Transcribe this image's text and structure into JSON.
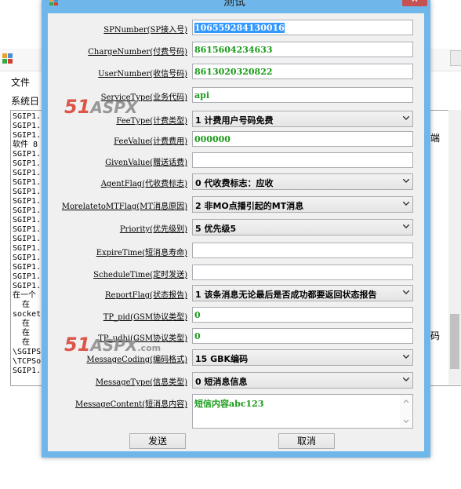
{
  "background": {
    "menu": "文件",
    "log_label": "系统日",
    "log_lines": [
      "SGIP1.",
      "SGIP1.",
      "SGIP1.",
      "软件 8",
      "SGIP1.",
      "SGIP1.",
      "SGIP1.",
      "SGIP1.",
      "SGIP1.",
      "SGIP1.",
      "SGIP1.",
      "SGIP1.",
      "SGIP1.",
      "SGIP1.",
      "SGIP1.",
      "SGIP1.",
      "SGIP1.",
      "SGIP1.",
      "SGIP1.",
      "在一个",
      "  在",
      "socket",
      "  在",
      "  在",
      "  在",
      "\\SGIPS",
      "\\TCPSo",
      "SGIP1."
    ],
    "side_text_1": "端",
    "side_text_2": "码"
  },
  "dialog": {
    "title": "测试",
    "close_glyph": "✕",
    "fields": [
      {
        "label": "SPNumber(SP接入号)",
        "type": "text",
        "value": "106559284130016",
        "selected": true
      },
      {
        "label": "ChargeNumber(付费号码)",
        "type": "text",
        "value": "8615604234633"
      },
      {
        "label": "UserNumber(收信号码)",
        "type": "text",
        "value": "8613020320822"
      },
      {
        "label": "ServiceType(业务代码)",
        "type": "text",
        "value": "api"
      },
      {
        "label": "FeeType(计费类型)",
        "type": "combo",
        "value": "1    计费用户号码免费"
      },
      {
        "label": "FeeValue(计费费用)",
        "type": "text",
        "value": "000000"
      },
      {
        "label": "GivenValue(赠送话费)",
        "type": "text",
        "value": ""
      },
      {
        "label": "AgentFlag(代收费标志)",
        "type": "combo",
        "value": "0  代收费标志：应收"
      },
      {
        "label": "MorelatetoMTFlag(MT消息原因)",
        "type": "combo",
        "value": "2    非MO点播引起的MT消息"
      },
      {
        "label": "Priority(优先级别)",
        "type": "combo",
        "value": "5  优先级5"
      },
      {
        "label": "ExpireTime(短消息寿命)",
        "type": "text",
        "value": ""
      },
      {
        "label": "ScheduleTime(定时发送)",
        "type": "text",
        "value": ""
      },
      {
        "label": "ReportFlag(状态报告)",
        "type": "combo",
        "value": "1    该条消息无论最后是否成功都要返回状态报告"
      },
      {
        "label": "TP_pid(GSM协议类型)",
        "type": "text",
        "value": "0"
      },
      {
        "label": "TP_udhi(GSM协议类型)",
        "type": "text",
        "value": "0"
      },
      {
        "label": "MessageCoding(编码格式)",
        "type": "combo",
        "value": "15  GBK编码"
      },
      {
        "label": "MessageType(信息类型)",
        "type": "combo",
        "value": "0  短消息信息"
      },
      {
        "label": "MessageContent(短消息内容)",
        "type": "textarea",
        "value": "短信内容abc123"
      }
    ],
    "send_button": "发送",
    "cancel_button": "取消"
  },
  "watermark": {
    "n": "51",
    "a": "ASPX",
    "c": ".com"
  },
  "colors": {
    "value_text": "#1a9b1a",
    "dialog_frame": "#6fb7ea",
    "close_button": "#c75050",
    "selection": "#3399ff"
  }
}
